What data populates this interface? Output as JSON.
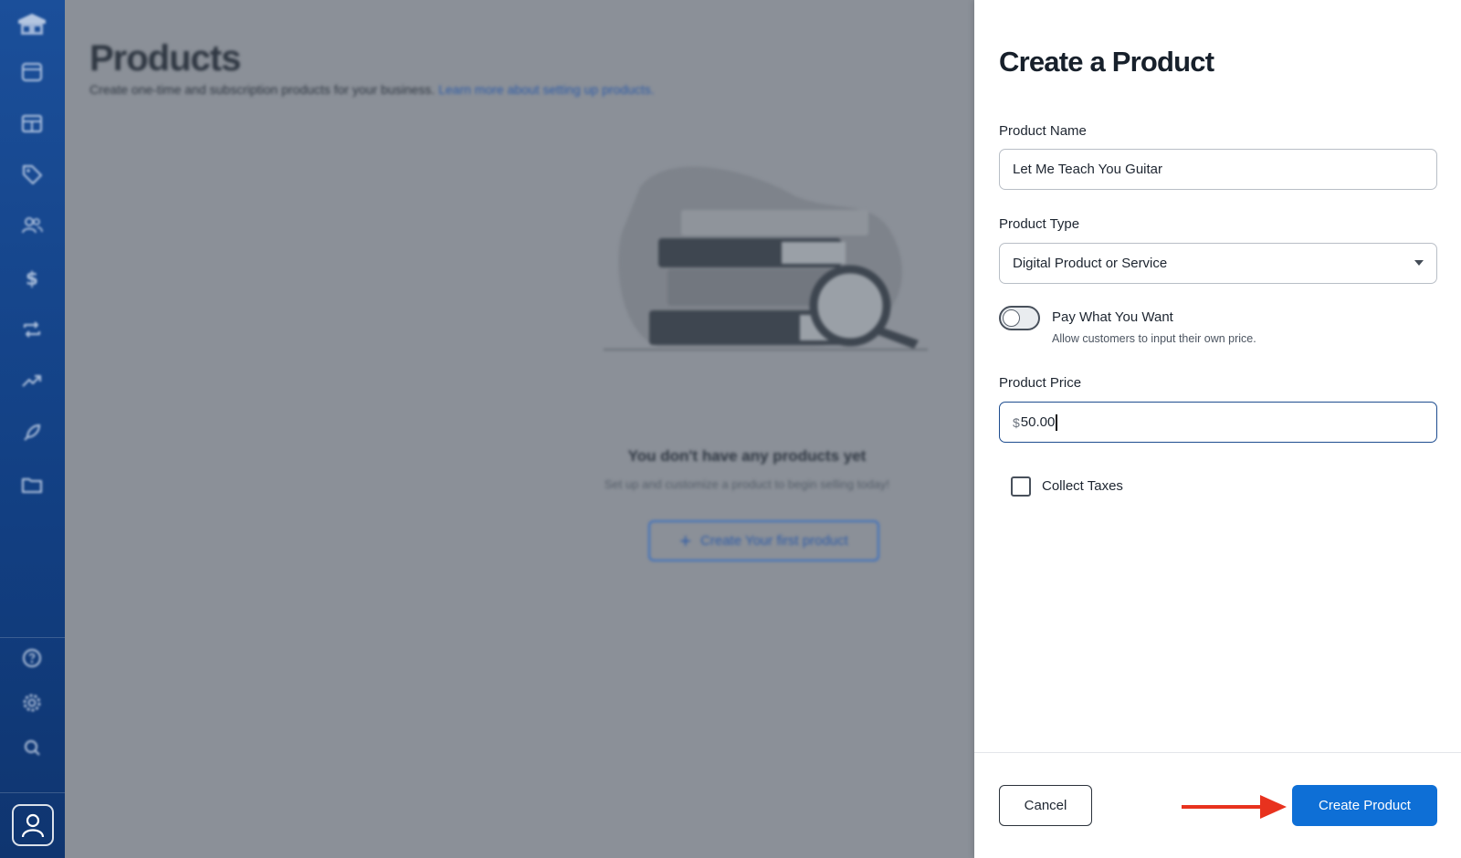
{
  "background_page": {
    "title": "Products",
    "subtitle": "Create one-time and subscription products for your business.",
    "learn_more_link": "Learn more about setting up products.",
    "empty_state": {
      "title": "You don't have any products yet",
      "subtitle": "Set up and customize a product to begin selling today!",
      "button_label": "Create Your first product"
    }
  },
  "sidebar": {
    "icons": [
      "logo-icon",
      "dashboard-icon",
      "storefront-icon",
      "tag-icon",
      "users-icon",
      "dollar-icon",
      "repeat-icon",
      "trending-icon",
      "rocket-icon",
      "folder-icon",
      "help-icon",
      "settings-icon",
      "search-icon",
      "user-icon"
    ]
  },
  "panel": {
    "title": "Create a Product",
    "product_name": {
      "label": "Product Name",
      "value": "Let Me Teach You Guitar"
    },
    "product_type": {
      "label": "Product Type",
      "selected": "Digital Product or Service"
    },
    "pay_what_you_want": {
      "label": "Pay What You Want",
      "help": "Allow customers to input their own price.",
      "enabled": false
    },
    "product_price": {
      "label": "Product Price",
      "prefix": "$",
      "value": "50.00"
    },
    "collect_taxes": {
      "label": "Collect Taxes",
      "checked": false
    },
    "cancel_label": "Cancel",
    "create_label": "Create Product"
  },
  "colors": {
    "primary": "#0e6fd6",
    "sidebar": "#123f82",
    "annotation_arrow": "#e8321e"
  }
}
